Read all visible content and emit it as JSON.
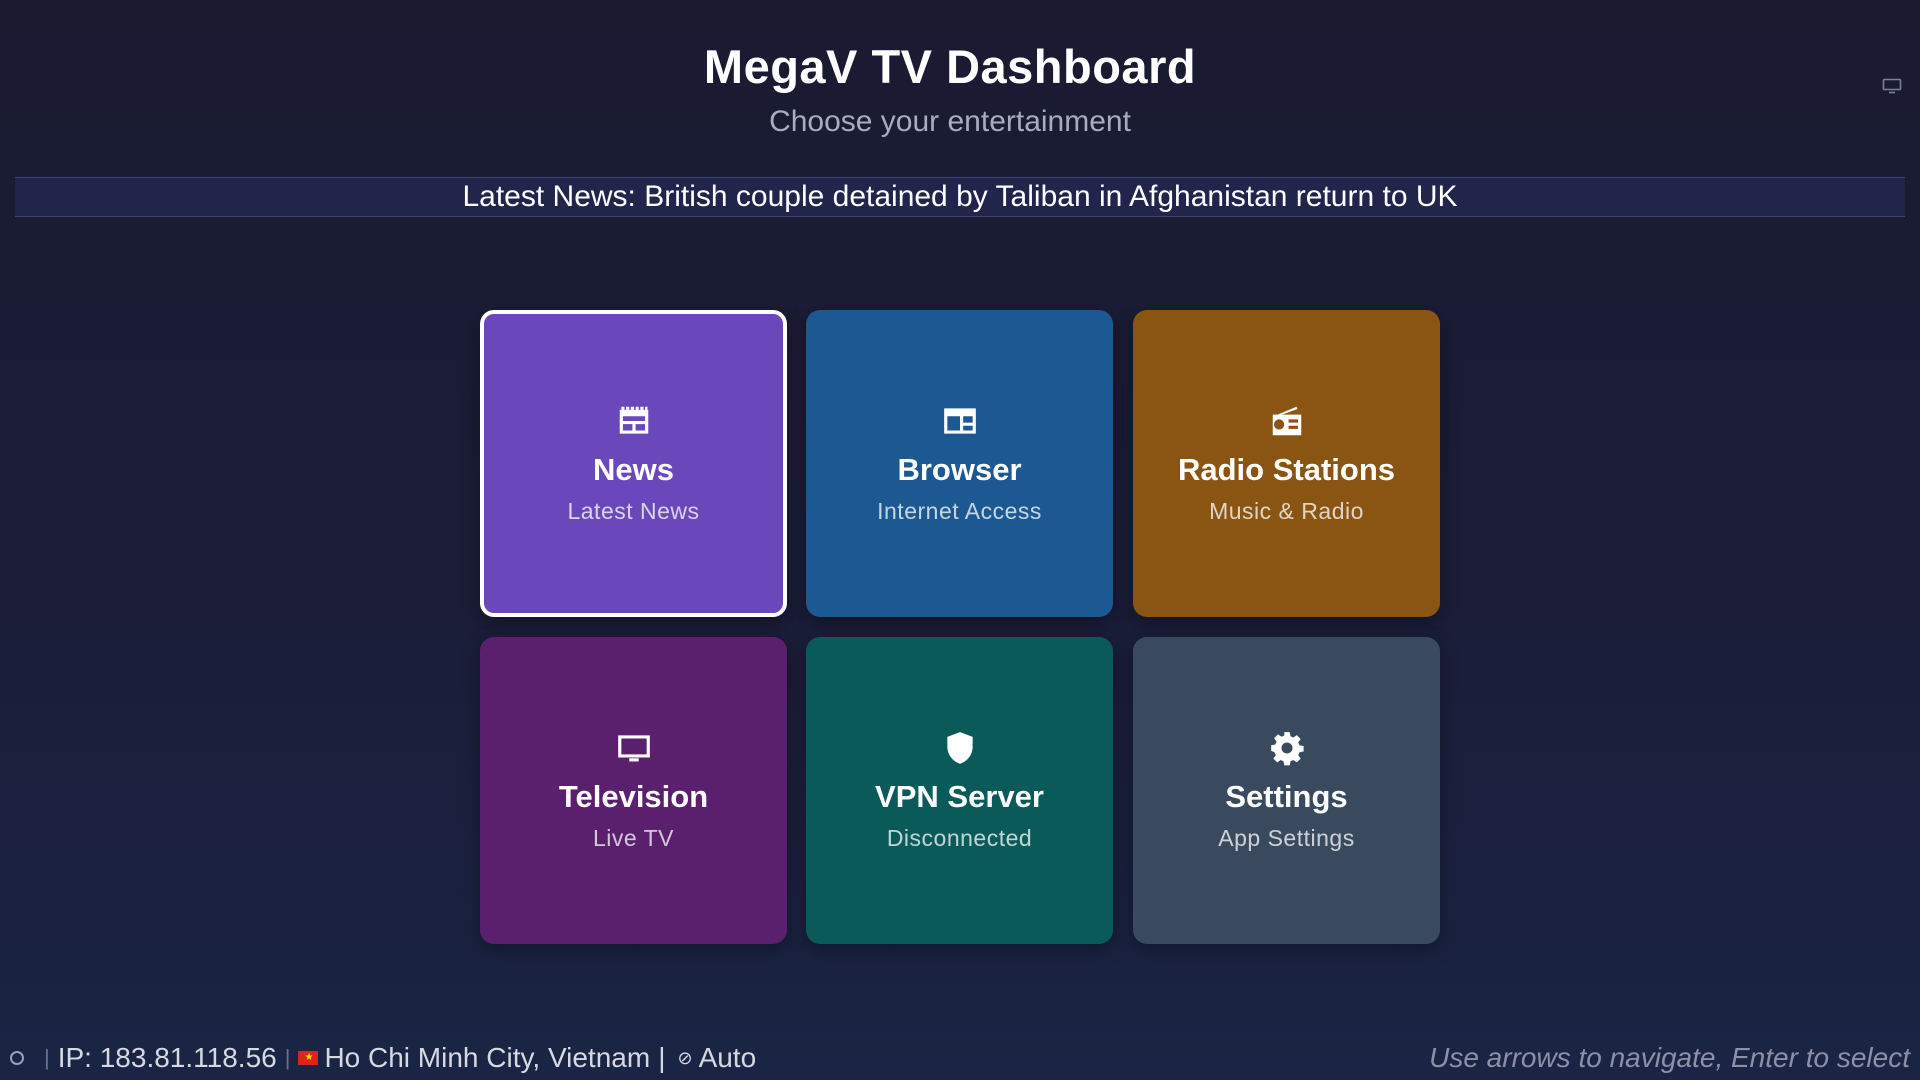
{
  "header": {
    "title": "MegaV TV Dashboard",
    "subtitle": "Choose your entertainment",
    "corner_icon": "display-icon"
  },
  "ticker": {
    "text": "Latest News: British couple detained by Taliban in Afghanistan return to UK"
  },
  "tiles": [
    {
      "label": "News",
      "sub": "Latest News",
      "icon": "newspaper-icon",
      "color": "#6a48bc",
      "focused": true
    },
    {
      "label": "Browser",
      "sub": "Internet Access",
      "icon": "browser-window-icon",
      "color": "#1c5891",
      "focused": false
    },
    {
      "label": "Radio Stations",
      "sub": "Music & Radio",
      "icon": "radio-icon",
      "color": "#8a5413",
      "focused": false
    },
    {
      "label": "Television",
      "sub": "Live TV",
      "icon": "tv-icon",
      "color": "#5a1f6d",
      "focused": false
    },
    {
      "label": "VPN Server",
      "sub": "Disconnected",
      "icon": "shield-icon",
      "color": "#0b5a5a",
      "focused": false
    },
    {
      "label": "Settings",
      "sub": "App Settings",
      "icon": "gear-icon",
      "color": "#3a4a5e",
      "focused": false
    }
  ],
  "status": {
    "ip": "IP: 183.81.118.56",
    "location": "Ho Chi Minh City, Vietnam",
    "separator": "|",
    "mode": "Auto"
  },
  "hint": "Use arrows to navigate, Enter to select"
}
